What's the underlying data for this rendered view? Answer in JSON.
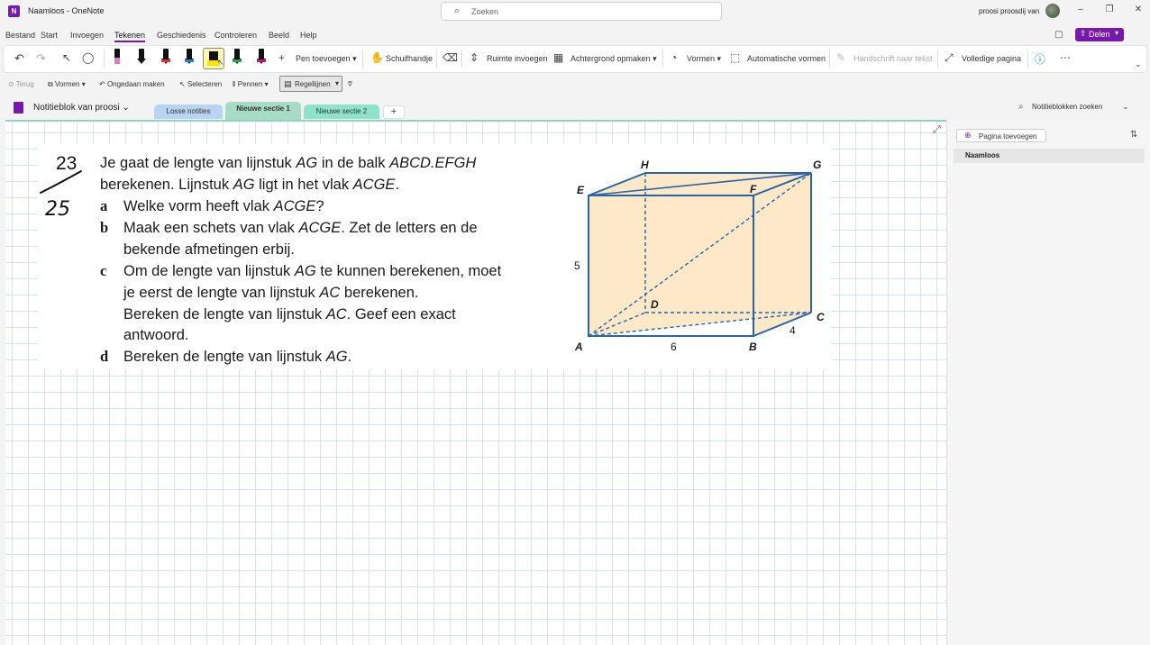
{
  "titlebar": {
    "title": "Naamloos - OneNote",
    "search_placeholder": "Zoeken",
    "user": "proosi proosdij van"
  },
  "menu": [
    "Bestand",
    "Start",
    "Invoegen",
    "Tekenen",
    "Geschiedenis",
    "Controleren",
    "Beeld",
    "Help"
  ],
  "menu_active": "Tekenen",
  "share_label": "Delen",
  "ribbon": {
    "pen_add": "Pen toevoegen",
    "slide": "Schuifhandje",
    "insert_space": "Ruimte invoegen",
    "background": "Achtergrond opmaken",
    "shapes": "Vormen",
    "auto_shapes": "Automatische vormen",
    "ink_to_text": "Handschrift naar tekst",
    "full_page": "Volledige pagina"
  },
  "subbar": {
    "back": "Terug",
    "shapes": "Vormen",
    "undo": "Ongedaan maken",
    "select": "Selecteren",
    "pens": "Pennen",
    "rules": "Regellijnen"
  },
  "notebook": {
    "name": "Notitieblok van proosi",
    "tabs": [
      {
        "label": "Losse notities",
        "color": "#b9d3f2"
      },
      {
        "label": "Nieuwe sectie 1",
        "color": "#a6dcc6"
      },
      {
        "label": "Nieuwe sectie 2",
        "color": "#8fe3c8"
      }
    ],
    "search": "Notitieblokken zoeken"
  },
  "exercise": {
    "number": "23",
    "handwritten_score": "25",
    "intro_line1_parts": [
      "Je gaat de lengte van lijnstuk ",
      "AG",
      " in de balk ",
      "ABCD.EFGH"
    ],
    "intro_line2_parts": [
      "berekenen. Lijnstuk ",
      "AG",
      " ligt in het vlak ",
      "ACGE",
      "."
    ],
    "a_label": "a",
    "a_parts": [
      "Welke vorm heeft vlak ",
      "ACGE",
      "?"
    ],
    "b_label": "b",
    "b_line1_parts": [
      "Maak een schets van vlak ",
      "ACGE",
      ". Zet de letters en de"
    ],
    "b_line2": "bekende afmetingen erbij.",
    "c_label": "c",
    "c_line1_parts": [
      "Om de lengte van lijnstuk ",
      "AG",
      " te kunnen berekenen, moet"
    ],
    "c_line2_parts": [
      "je eerst de lengte van lijnstuk ",
      "AC",
      " berekenen."
    ],
    "c_line3_parts": [
      "Bereken de lengte van lijnstuk ",
      "AC",
      ". Geef een exact"
    ],
    "c_line4": "antwoord.",
    "d_label": "d",
    "d_parts": [
      "Bereken de lengte van lijnstuk ",
      "AG",
      "."
    ]
  },
  "figure": {
    "vertices": [
      "A",
      "B",
      "C",
      "D",
      "E",
      "F",
      "G",
      "H"
    ],
    "dim_height": "5",
    "dim_length": "6",
    "dim_width": "4",
    "line_color": "#2a63a6",
    "fill_color": "#fde8c8"
  },
  "rpanel": {
    "add_page": "Pagina toevoegen",
    "page": "Naamloos"
  }
}
